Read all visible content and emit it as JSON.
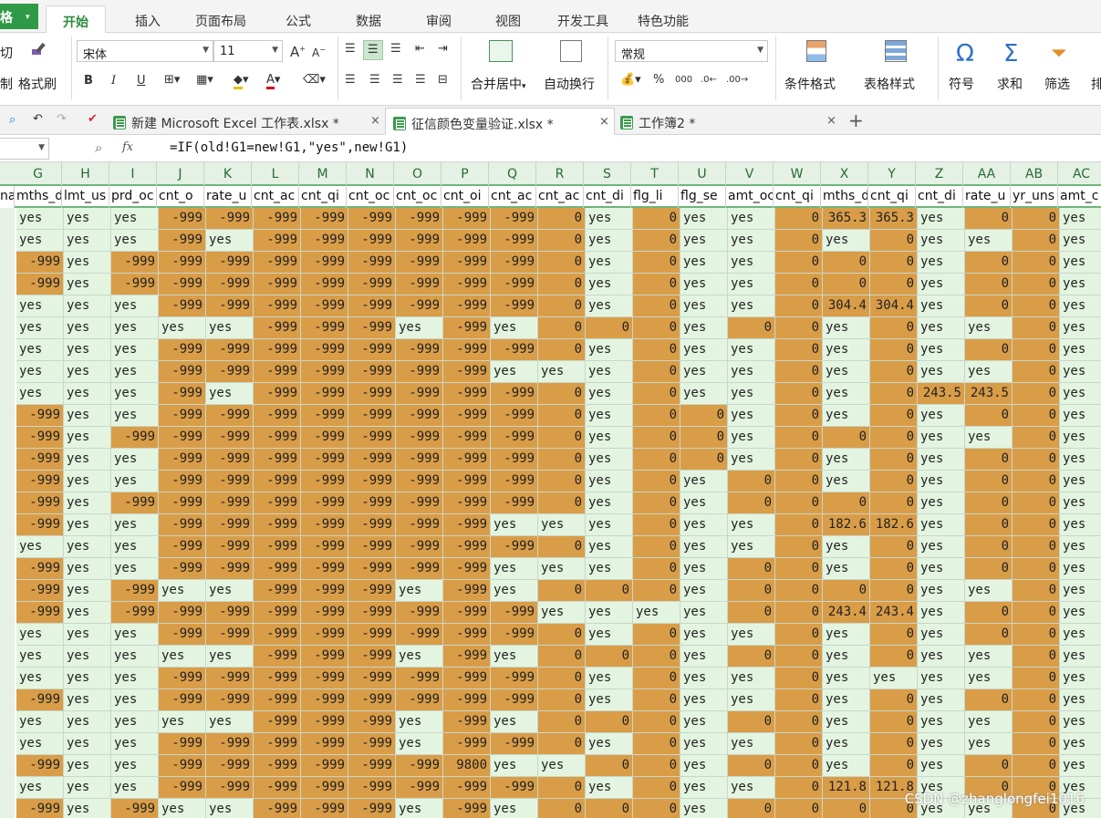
{
  "app": {
    "menu_button": "格",
    "menu_arrow": "▾"
  },
  "menu": {
    "items": [
      "开始",
      "插入",
      "页面布局",
      "公式",
      "数据",
      "审阅",
      "视图",
      "开发工具",
      "特色功能"
    ],
    "active_index": 0
  },
  "ribbon": {
    "clip_fragment_top": "切",
    "clip_fragment_bottom": "制",
    "format_painter": "格式刷",
    "font_name": "宋体",
    "font_size": "11",
    "number_format": "常规",
    "merge_center": "合并居中",
    "merge_center_arrow": "▾",
    "wrap_text": "自动换行",
    "cond_format": "条件格式",
    "table_style": "表格样式",
    "symbol": "符号",
    "sum": "求和",
    "filter": "筛选",
    "sort_fragment": "排",
    "bold": "B",
    "italic": "I",
    "underline": "U",
    "percent": "%",
    "comma": "000"
  },
  "tabs": [
    {
      "label": "新建 Microsoft Excel 工作表.xlsx *",
      "active": false
    },
    {
      "label": "征信颜色变量验证.xlsx *",
      "active": true
    },
    {
      "label": "工作簿2 *",
      "active": false
    }
  ],
  "tab_add": "+",
  "formula_bar": {
    "name_box": "",
    "fx": "fx",
    "formula": "=IF(old!G1=new!G1,\"yes\",new!G1)"
  },
  "columns": [
    "G",
    "H",
    "I",
    "J",
    "K",
    "L",
    "M",
    "N",
    "O",
    "P",
    "Q",
    "R",
    "S",
    "T",
    "U",
    "V",
    "W",
    "X",
    "Y",
    "Z",
    "AA",
    "AB",
    "AC"
  ],
  "header_row": [
    "mths_d",
    "lmt_us",
    "prd_oc",
    "cnt_o",
    "rate_u",
    "cnt_ac",
    "cnt_qi",
    "cnt_oc",
    "cnt_oc",
    "cnt_oi",
    "cnt_ac",
    "cnt_ac",
    "cnt_di",
    "flg_li",
    "flg_se",
    "amt_oc",
    "cnt_qi",
    "mths_d",
    "cnt_qi",
    "cnt_di",
    "rate_u",
    "yr_uns",
    "amt_c"
  ],
  "name_fragment": "na",
  "rows": [
    [
      "yes",
      "yes",
      "yes",
      "-999",
      "-999",
      "-999",
      "-999",
      "-999",
      "-999",
      "-999",
      "-999",
      "0",
      "yes",
      "0",
      "yes",
      "yes",
      "0",
      "365.3",
      "365.3",
      "yes",
      "0",
      "0",
      "yes"
    ],
    [
      "yes",
      "yes",
      "yes",
      "-999",
      "yes",
      "-999",
      "-999",
      "-999",
      "-999",
      "-999",
      "-999",
      "0",
      "yes",
      "0",
      "yes",
      "yes",
      "0",
      "yes",
      "0",
      "yes",
      "yes",
      "0",
      "yes"
    ],
    [
      "-999",
      "yes",
      "-999",
      "-999",
      "-999",
      "-999",
      "-999",
      "-999",
      "-999",
      "-999",
      "-999",
      "0",
      "yes",
      "0",
      "yes",
      "yes",
      "0",
      "0",
      "0",
      "yes",
      "0",
      "0",
      "yes"
    ],
    [
      "-999",
      "yes",
      "-999",
      "-999",
      "-999",
      "-999",
      "-999",
      "-999",
      "-999",
      "-999",
      "-999",
      "0",
      "yes",
      "0",
      "yes",
      "yes",
      "0",
      "0",
      "0",
      "yes",
      "0",
      "0",
      "yes"
    ],
    [
      "yes",
      "yes",
      "yes",
      "-999",
      "-999",
      "-999",
      "-999",
      "-999",
      "-999",
      "-999",
      "-999",
      "0",
      "yes",
      "0",
      "yes",
      "yes",
      "0",
      "304.4",
      "304.4",
      "yes",
      "0",
      "0",
      "yes"
    ],
    [
      "yes",
      "yes",
      "yes",
      "yes",
      "yes",
      "-999",
      "-999",
      "-999",
      "yes",
      "-999",
      "yes",
      "0",
      "0",
      "0",
      "yes",
      "0",
      "0",
      "yes",
      "0",
      "yes",
      "yes",
      "0",
      "yes"
    ],
    [
      "yes",
      "yes",
      "yes",
      "-999",
      "-999",
      "-999",
      "-999",
      "-999",
      "-999",
      "-999",
      "-999",
      "0",
      "yes",
      "0",
      "yes",
      "yes",
      "0",
      "yes",
      "0",
      "yes",
      "0",
      "0",
      "yes"
    ],
    [
      "yes",
      "yes",
      "yes",
      "-999",
      "-999",
      "-999",
      "-999",
      "-999",
      "-999",
      "-999",
      "yes",
      "yes",
      "yes",
      "0",
      "yes",
      "yes",
      "0",
      "yes",
      "0",
      "yes",
      "yes",
      "0",
      "yes"
    ],
    [
      "yes",
      "yes",
      "yes",
      "-999",
      "yes",
      "-999",
      "-999",
      "-999",
      "-999",
      "-999",
      "-999",
      "0",
      "yes",
      "0",
      "yes",
      "yes",
      "0",
      "yes",
      "0",
      "243.5",
      "243.5",
      "0",
      "yes"
    ],
    [
      "-999",
      "yes",
      "yes",
      "-999",
      "-999",
      "-999",
      "-999",
      "-999",
      "-999",
      "-999",
      "-999",
      "0",
      "yes",
      "0",
      "0",
      "yes",
      "0",
      "yes",
      "0",
      "yes",
      "0",
      "0",
      "yes"
    ],
    [
      "-999",
      "yes",
      "-999",
      "-999",
      "-999",
      "-999",
      "-999",
      "-999",
      "-999",
      "-999",
      "-999",
      "0",
      "yes",
      "0",
      "0",
      "yes",
      "0",
      "0",
      "0",
      "yes",
      "yes",
      "0",
      "yes"
    ],
    [
      "-999",
      "yes",
      "yes",
      "-999",
      "-999",
      "-999",
      "-999",
      "-999",
      "-999",
      "-999",
      "-999",
      "0",
      "yes",
      "0",
      "0",
      "yes",
      "0",
      "yes",
      "0",
      "yes",
      "0",
      "0",
      "yes"
    ],
    [
      "-999",
      "yes",
      "yes",
      "-999",
      "-999",
      "-999",
      "-999",
      "-999",
      "-999",
      "-999",
      "-999",
      "0",
      "yes",
      "0",
      "yes",
      "0",
      "0",
      "yes",
      "0",
      "yes",
      "0",
      "0",
      "yes"
    ],
    [
      "-999",
      "yes",
      "-999",
      "-999",
      "-999",
      "-999",
      "-999",
      "-999",
      "-999",
      "-999",
      "-999",
      "0",
      "yes",
      "0",
      "yes",
      "0",
      "0",
      "0",
      "0",
      "yes",
      "0",
      "0",
      "yes"
    ],
    [
      "-999",
      "yes",
      "yes",
      "-999",
      "-999",
      "-999",
      "-999",
      "-999",
      "-999",
      "-999",
      "yes",
      "yes",
      "yes",
      "0",
      "yes",
      "yes",
      "0",
      "182.6",
      "182.6",
      "yes",
      "0",
      "0",
      "yes"
    ],
    [
      "yes",
      "yes",
      "yes",
      "-999",
      "-999",
      "-999",
      "-999",
      "-999",
      "-999",
      "-999",
      "-999",
      "0",
      "yes",
      "0",
      "yes",
      "yes",
      "0",
      "yes",
      "0",
      "yes",
      "0",
      "0",
      "yes"
    ],
    [
      "-999",
      "yes",
      "yes",
      "-999",
      "-999",
      "-999",
      "-999",
      "-999",
      "-999",
      "-999",
      "yes",
      "yes",
      "yes",
      "0",
      "yes",
      "0",
      "0",
      "yes",
      "0",
      "yes",
      "0",
      "0",
      "yes"
    ],
    [
      "-999",
      "yes",
      "-999",
      "yes",
      "yes",
      "-999",
      "-999",
      "-999",
      "yes",
      "-999",
      "yes",
      "0",
      "0",
      "0",
      "yes",
      "0",
      "0",
      "0",
      "0",
      "yes",
      "yes",
      "0",
      "yes"
    ],
    [
      "-999",
      "yes",
      "-999",
      "-999",
      "-999",
      "-999",
      "-999",
      "-999",
      "-999",
      "-999",
      "-999",
      "yes",
      "yes",
      "yes",
      "yes",
      "0",
      "0",
      "243.4",
      "243.4",
      "yes",
      "0",
      "0",
      "yes"
    ],
    [
      "yes",
      "yes",
      "yes",
      "-999",
      "-999",
      "-999",
      "-999",
      "-999",
      "-999",
      "-999",
      "-999",
      "0",
      "yes",
      "0",
      "yes",
      "yes",
      "0",
      "yes",
      "0",
      "yes",
      "0",
      "0",
      "yes"
    ],
    [
      "yes",
      "yes",
      "yes",
      "yes",
      "yes",
      "-999",
      "-999",
      "-999",
      "yes",
      "-999",
      "yes",
      "0",
      "0",
      "0",
      "yes",
      "0",
      "0",
      "yes",
      "0",
      "yes",
      "yes",
      "0",
      "yes"
    ],
    [
      "yes",
      "yes",
      "yes",
      "-999",
      "-999",
      "-999",
      "-999",
      "-999",
      "-999",
      "-999",
      "-999",
      "0",
      "yes",
      "0",
      "yes",
      "yes",
      "0",
      "yes",
      "yes",
      "yes",
      "yes",
      "0",
      "yes"
    ],
    [
      "-999",
      "yes",
      "yes",
      "-999",
      "-999",
      "-999",
      "-999",
      "-999",
      "-999",
      "-999",
      "-999",
      "0",
      "yes",
      "0",
      "yes",
      "yes",
      "0",
      "yes",
      "0",
      "yes",
      "0",
      "0",
      "yes"
    ],
    [
      "yes",
      "yes",
      "yes",
      "yes",
      "yes",
      "-999",
      "-999",
      "-999",
      "yes",
      "-999",
      "yes",
      "0",
      "0",
      "0",
      "yes",
      "0",
      "0",
      "yes",
      "0",
      "yes",
      "yes",
      "0",
      "yes"
    ],
    [
      "yes",
      "yes",
      "yes",
      "-999",
      "-999",
      "-999",
      "-999",
      "-999",
      "yes",
      "-999",
      "-999",
      "0",
      "yes",
      "0",
      "yes",
      "yes",
      "0",
      "yes",
      "0",
      "yes",
      "yes",
      "0",
      "yes"
    ],
    [
      "-999",
      "yes",
      "yes",
      "-999",
      "-999",
      "-999",
      "-999",
      "-999",
      "-999",
      "9800",
      "yes",
      "yes",
      "0",
      "0",
      "yes",
      "0",
      "0",
      "yes",
      "0",
      "yes",
      "0",
      "0",
      "yes"
    ],
    [
      "yes",
      "yes",
      "yes",
      "-999",
      "-999",
      "-999",
      "-999",
      "-999",
      "-999",
      "-999",
      "-999",
      "0",
      "yes",
      "0",
      "yes",
      "yes",
      "0",
      "121.8",
      "121.8",
      "yes",
      "0",
      "0",
      "yes"
    ],
    [
      "-999",
      "yes",
      "-999",
      "yes",
      "yes",
      "-999",
      "-999",
      "-999",
      "yes",
      "-999",
      "yes",
      "0",
      "0",
      "0",
      "yes",
      "0",
      "0",
      "0",
      "0",
      "yes",
      "yes",
      "0",
      "yes"
    ]
  ],
  "watermark": "CSDN @zhanglongfei1016"
}
